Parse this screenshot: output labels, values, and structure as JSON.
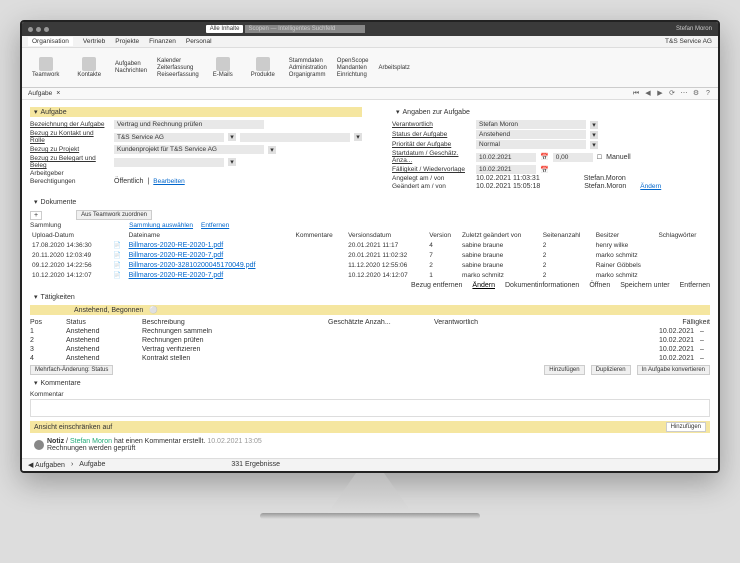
{
  "titlebar": {
    "search_chip": "Alle Inhalte",
    "search_placeholder": "Scopen — Intelligentes Suchfeld",
    "user": "Stefan Moron"
  },
  "menubar": {
    "items": [
      "Organisation",
      "Vertrieb",
      "Projekte",
      "Finanzen",
      "Personal"
    ],
    "org": "T&S Service AG"
  },
  "ribbon": {
    "big": [
      {
        "label": "Teamwork"
      },
      {
        "label": "Kontakte"
      }
    ],
    "group1": [
      "Aufgaben",
      "Nachrichten"
    ],
    "group2": [
      "Kalender",
      "Zeiterfassung",
      "Reiseerfassung"
    ],
    "big2": [
      {
        "label": "E-Mails"
      },
      {
        "label": "Produkte"
      }
    ],
    "group3": [
      "Stammdaten",
      "Administration",
      "Organigramm"
    ],
    "group4": [
      "OpenScope",
      "Mandanten",
      "Einrichtung"
    ],
    "group5": [
      "Arbeitsplatz"
    ]
  },
  "toolbar": {
    "tab": "Aufgabe",
    "close": "×"
  },
  "sections": {
    "aufgabe": "Aufgabe",
    "angaben": "Angaben zur Aufgabe",
    "dokumente": "Dokumente",
    "taetigkeiten": "Tätigkeiten",
    "kommentare": "Kommentare"
  },
  "form_left": {
    "bezeichnung": {
      "label": "Bezeichnung der Aufgabe",
      "value": "Vertrag und Rechnung prüfen"
    },
    "kontakt": {
      "label": "Bezug zu Kontakt und Rolle",
      "value": "T&S Service AG"
    },
    "projekt": {
      "label": "Bezug zu Projekt",
      "value": "Kundenprojekt für T&S Service AG"
    },
    "beleg": {
      "label": "Bezug zu Belegart und Beleg",
      "value": ""
    },
    "arbeitgeber": {
      "label": "Arbeitgeber",
      "value": ""
    },
    "berechtigungen": {
      "label": "Berechtigungen",
      "value": "Öffentlich",
      "edit": "Bearbeiten"
    }
  },
  "form_right": {
    "verantwortlich": {
      "label": "Verantwortlich",
      "value": "Stefan Moron"
    },
    "status": {
      "label": "Status der Aufgabe",
      "value": "Anstehend"
    },
    "prioritaet": {
      "label": "Priorität der Aufgabe",
      "value": "Normal"
    },
    "startdatum": {
      "label": "Startdatum / Geschätz. Anza...",
      "value": "10.02.2021",
      "extra": "0,00",
      "manuell": "Manuell"
    },
    "faelligkeit": {
      "label": "Fälligkeit / Wiedervorlage",
      "value": "10.02.2021"
    },
    "angelegt": {
      "label": "Angelegt am / von",
      "value": "10.02.2021 11:03:31",
      "by": "Stefan.Moron"
    },
    "geaendert": {
      "label": "Geändert am / von",
      "value": "10.02.2021 15:05:18",
      "by": "Stefan.Moron",
      "edit": "Ändern"
    }
  },
  "docs": {
    "teamwork_btn": "Aus Teamwork zuordnen",
    "actions": [
      "Sammlung",
      "Sammlung auswählen",
      "Entfernen"
    ],
    "add": "+",
    "cols": [
      "Upload-Datum",
      "",
      "Dateiname",
      "Kommentare",
      "Versionsdatum",
      "Version",
      "Zuletzt geändert von",
      "Seitenanzahl",
      "Besitzer",
      "Schlagwörter"
    ],
    "rows": [
      {
        "u": "17.08.2020 14:36:30",
        "f": "Billmaros-2020-RE-2020-1.pdf",
        "v": "20.01.2021 11:17",
        "ver": "4",
        "by": "sabine braune",
        "p": "2",
        "o": "henry wilke"
      },
      {
        "u": "20.11.2020 12:03:49",
        "f": "Billmaros-2020-RE-2020-7.pdf",
        "v": "20.01.2021 11:02:32",
        "ver": "7",
        "by": "sabine braune",
        "p": "2",
        "o": "marko schmitz"
      },
      {
        "u": "09.12.2020 14:22:56",
        "f": "Billmaros-2020-32810200045170049.pdf",
        "v": "11.12.2020 12:55:06",
        "ver": "2",
        "by": "sabine braune",
        "p": "2",
        "o": "Rainer Göbbels"
      },
      {
        "u": "10.12.2020 14:12:07",
        "f": "Billmaros-2020-RE-2020-7.pdf",
        "v": "10.12.2020 14:12:07",
        "ver": "1",
        "by": "marko schmitz",
        "p": "2",
        "o": "marko schmitz"
      }
    ],
    "row_actions": [
      "Bezug entfernen",
      "Ändern",
      "Dokumentinformationen",
      "Öffnen",
      "Speichern unter",
      "Entfernen"
    ]
  },
  "activities": {
    "status_header": "Anstehend, Begonnen",
    "cols": [
      "Pos",
      "Status",
      "Beschreibung",
      "Geschätzte Anzah...",
      "Verantwortlich",
      "Fälligkeit"
    ],
    "rows": [
      {
        "p": "1",
        "s": "Anstehend",
        "b": "Rechnungen sammeln",
        "f": "10.02.2021"
      },
      {
        "p": "2",
        "s": "Anstehend",
        "b": "Rechnungen prüfen",
        "f": "10.02.2021"
      },
      {
        "p": "3",
        "s": "Anstehend",
        "b": "Vertrag verifizieren",
        "f": "10.02.2021"
      },
      {
        "p": "4",
        "s": "Anstehend",
        "b": "Kontrakt stellen",
        "f": "10.02.2021"
      }
    ],
    "mehrfach": "Mehrfach-Änderung: Status",
    "btns": [
      "Hinzufügen",
      "Duplizieren",
      "In Aufgabe konvertieren"
    ]
  },
  "kommentar": {
    "label": "Kommentar",
    "ansicht": "Ansicht einschränken auf",
    "btn": "Hinzufügen"
  },
  "note": {
    "label": "Notiz",
    "user": "Stefan Moron",
    "rest": "hat einen Kommentar erstellt.",
    "time": "10.02.2021 13:05",
    "body": "Rechnungen werden geprüft"
  },
  "breadcrumb": {
    "items": [
      "Aufgaben",
      "Aufgabe"
    ],
    "count": "331 Ergebnisse"
  }
}
